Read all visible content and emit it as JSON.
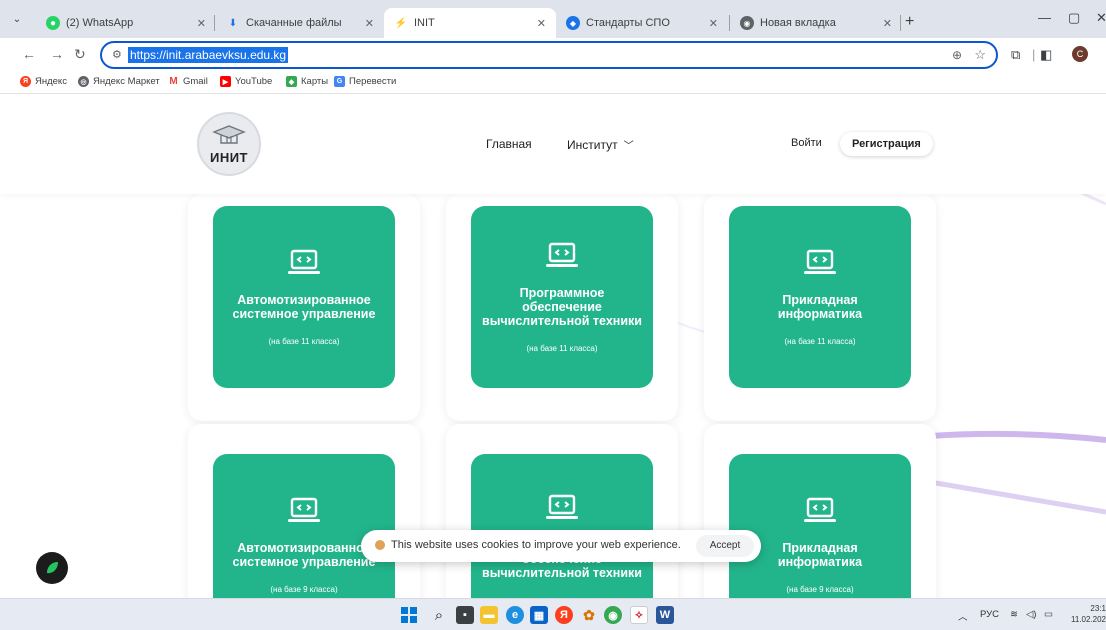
{
  "browser": {
    "tabs": [
      {
        "label": "(2) WhatsApp",
        "icon": "whatsapp-icon",
        "color": "#25d366",
        "active": false
      },
      {
        "label": "Скачанные файлы",
        "icon": "download-icon",
        "color": "#1a73e8",
        "active": false
      },
      {
        "label": "INIT",
        "icon": "init-icon",
        "color": "#7b1fa2",
        "active": true
      },
      {
        "label": "Стандарты СПО",
        "icon": "google-drive-icon",
        "color": "#1a73e8",
        "active": false
      },
      {
        "label": "Новая вкладка",
        "icon": "chrome-icon",
        "color": "#5f6368",
        "active": false
      }
    ],
    "url": "https://init.arabaevksu.edu.kg",
    "profile_initial": "C",
    "bookmarks": [
      {
        "label": "Яндекс",
        "color": "#fc3f1d",
        "glyph": "Я"
      },
      {
        "label": "Яндекс Маркет",
        "color": "#5f6368",
        "glyph": "◎"
      },
      {
        "label": "Gmail",
        "color": "#ea4335",
        "glyph": "M"
      },
      {
        "label": "YouTube",
        "color": "#ff0000",
        "glyph": "▶"
      },
      {
        "label": "Карты",
        "color": "#34a853",
        "glyph": "◆"
      },
      {
        "label": "Перевести",
        "color": "#4285f4",
        "glyph": "G"
      }
    ]
  },
  "site": {
    "logo_text": "ИНИТ",
    "nav": {
      "home": "Главная",
      "institute": "Институт"
    },
    "login": "Войти",
    "register": "Регистрация",
    "accent_color": "#22b58c"
  },
  "cards": [
    {
      "title": "Автомотизированное системное управление",
      "subtitle": "(на базе 11 класса)"
    },
    {
      "title": "Программное обеспечение вычислительной техники",
      "subtitle": "(на базе 11 класса)"
    },
    {
      "title": "Прикладная информатика",
      "subtitle": "(на базе 11 класса)"
    },
    {
      "title": "Автомотизированное системное управление",
      "subtitle": "(на базе 9 класса)"
    },
    {
      "title": "Программное обеспечение вычислительной техники",
      "subtitle": ""
    },
    {
      "title": "Прикладная информатика",
      "subtitle": "(на базе 9 класса)"
    }
  ],
  "cookie": {
    "text": "This website uses cookies to improve your web experience.",
    "accept": "Accept"
  },
  "taskbar": {
    "lang": "РУС",
    "time": "23:1",
    "date": "11.02.202"
  }
}
